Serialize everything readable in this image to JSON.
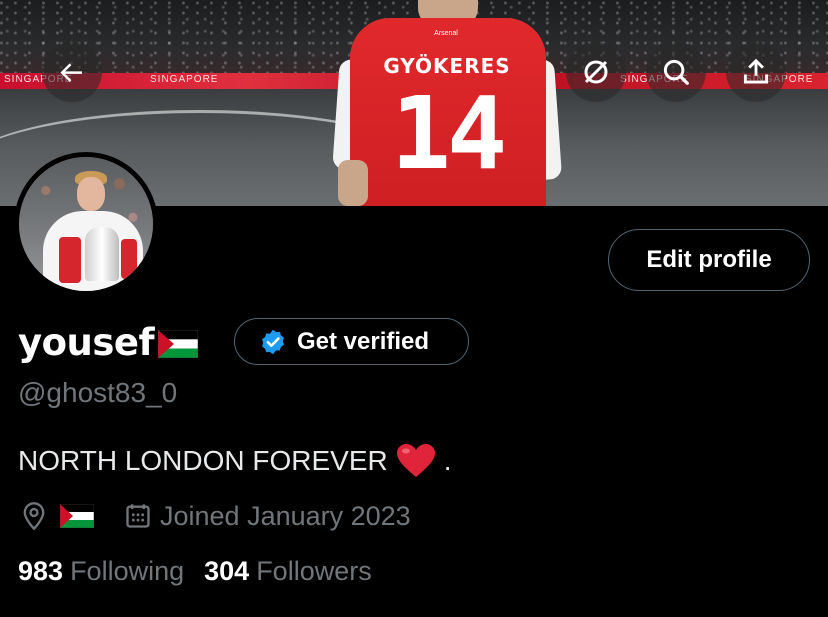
{
  "banner": {
    "shirt_name": "GYÖKERES",
    "shirt_number": "14",
    "shirt_collar_text": "Arsenal",
    "ad_text": "SINGAPORE",
    "buttons": [
      {
        "name": "back-button",
        "icon": "arrow-left-icon"
      },
      {
        "name": "grok-button",
        "icon": "grok-icon"
      },
      {
        "name": "search-button",
        "icon": "search-icon"
      },
      {
        "name": "share-button",
        "icon": "share-icon"
      }
    ]
  },
  "profile": {
    "display_name": "yousef",
    "handle": "@ghost83_0",
    "bio": "NORTH LONDON FOREVER",
    "bio_suffix": ".",
    "joined": "Joined January 2023",
    "following_count": "983",
    "following_label": "Following",
    "followers_count": "304",
    "followers_label": "Followers"
  },
  "actions": {
    "edit_profile_label": "Edit profile",
    "get_verified_label": "Get verified"
  },
  "colors": {
    "background": "#000000",
    "primary_text": "#e7e9ea",
    "secondary_text": "#71767b",
    "border": "#536471",
    "verified_blue": "#1d9bf0",
    "heart_red": "#e0243a"
  }
}
